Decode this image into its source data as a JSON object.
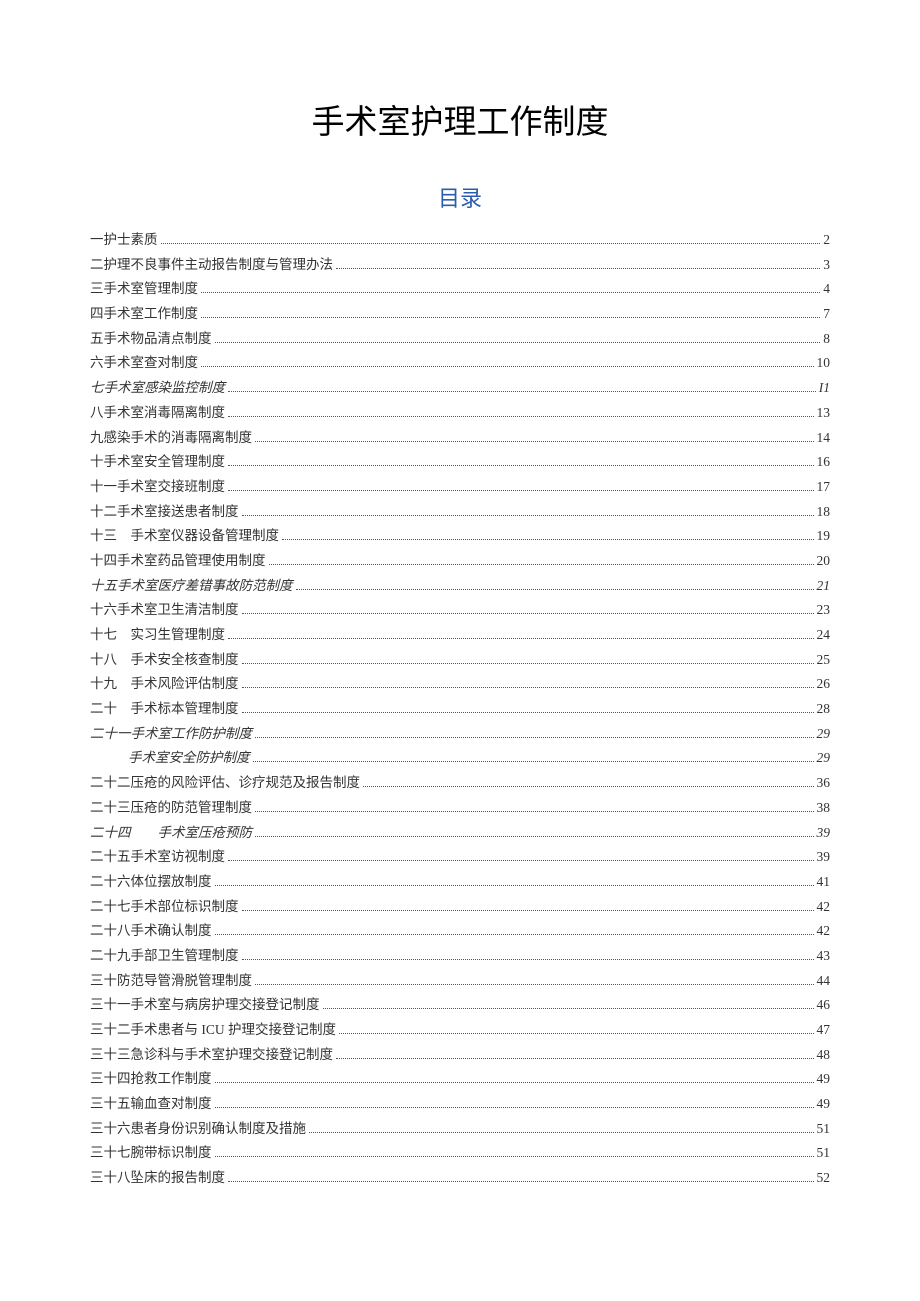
{
  "title": "手术室护理工作制度",
  "toc_title": "目录",
  "toc": [
    {
      "label": "一护士素质",
      "page": "2",
      "indent": false,
      "italic": false
    },
    {
      "label": "二护理不良事件主动报告制度与管理办法",
      "page": "3",
      "indent": false,
      "italic": false
    },
    {
      "label": "三手术室管理制度",
      "page": "4",
      "indent": false,
      "italic": false
    },
    {
      "label": "四手术室工作制度",
      "page": "7",
      "indent": false,
      "italic": false
    },
    {
      "label": "五手术物品清点制度",
      "page": "8",
      "indent": false,
      "italic": false
    },
    {
      "label": "六手术室查对制度",
      "page": "10",
      "indent": false,
      "italic": false
    },
    {
      "label": "七手术室感染监控制度",
      "page": "I1",
      "indent": false,
      "italic": true
    },
    {
      "label": "八手术室消毒隔离制度",
      "page": "13",
      "indent": false,
      "italic": false
    },
    {
      "label": "九感染手术的消毒隔离制度",
      "page": "14",
      "indent": false,
      "italic": false
    },
    {
      "label": "十手术室安全管理制度",
      "page": "16",
      "indent": false,
      "italic": false
    },
    {
      "label": "十一手术室交接班制度",
      "page": "17",
      "indent": false,
      "italic": false
    },
    {
      "label": "十二手术室接送患者制度",
      "page": "18",
      "indent": false,
      "italic": false
    },
    {
      "label": "十三　手术室仪器设备管理制度",
      "page": "19",
      "indent": false,
      "italic": false
    },
    {
      "label": "十四手术室药品管理使用制度",
      "page": "20",
      "indent": false,
      "italic": false
    },
    {
      "label": "十五手术室医疗差错事故防范制度",
      "page": "21",
      "indent": false,
      "italic": true
    },
    {
      "label": "十六手术室卫生清洁制度",
      "page": "23",
      "indent": false,
      "italic": false
    },
    {
      "label": "十七　实习生管理制度",
      "page": "24",
      "indent": false,
      "italic": false
    },
    {
      "label": "十八　手术安全核查制度",
      "page": "25",
      "indent": false,
      "italic": false
    },
    {
      "label": "十九　手术风险评估制度",
      "page": "26",
      "indent": false,
      "italic": false
    },
    {
      "label": "二十　手术标本管理制度",
      "page": "28",
      "indent": false,
      "italic": false
    },
    {
      "label": "二十一手术室工作防护制度",
      "page": "29",
      "indent": false,
      "italic": true
    },
    {
      "label": "手术室安全防护制度",
      "page": "29",
      "indent": true,
      "italic": true
    },
    {
      "label": "二十二压疮的风险评估、诊疗规范及报告制度",
      "page": "36",
      "indent": false,
      "italic": false
    },
    {
      "label": "二十三压疮的防范管理制度",
      "page": "38",
      "indent": false,
      "italic": false
    },
    {
      "label": "二十四　　手术室压疮预防",
      "page": "39",
      "indent": false,
      "italic": true
    },
    {
      "label": "二十五手术室访视制度",
      "page": "39",
      "indent": false,
      "italic": false
    },
    {
      "label": "二十六体位摆放制度",
      "page": "41",
      "indent": false,
      "italic": false
    },
    {
      "label": "二十七手术部位标识制度",
      "page": "42",
      "indent": false,
      "italic": false
    },
    {
      "label": "二十八手术确认制度",
      "page": "42",
      "indent": false,
      "italic": false
    },
    {
      "label": "二十九手部卫生管理制度",
      "page": "43",
      "indent": false,
      "italic": false
    },
    {
      "label": "三十防范导管滑脱管理制度",
      "page": "44",
      "indent": false,
      "italic": false
    },
    {
      "label": "三十一手术室与病房护理交接登记制度",
      "page": "46",
      "indent": false,
      "italic": false
    },
    {
      "label": "三十二手术患者与 ICU 护理交接登记制度",
      "page": "47",
      "indent": false,
      "italic": false
    },
    {
      "label": "三十三急诊科与手术室护理交接登记制度",
      "page": "48",
      "indent": false,
      "italic": false
    },
    {
      "label": "三十四抢救工作制度",
      "page": "49",
      "indent": false,
      "italic": false
    },
    {
      "label": "三十五输血查对制度",
      "page": "49",
      "indent": false,
      "italic": false
    },
    {
      "label": "三十六患者身份识别确认制度及措施",
      "page": "51",
      "indent": false,
      "italic": false
    },
    {
      "label": "三十七腕带标识制度",
      "page": "51",
      "indent": false,
      "italic": false
    },
    {
      "label": "三十八坠床的报告制度",
      "page": "52",
      "indent": false,
      "italic": false
    }
  ]
}
